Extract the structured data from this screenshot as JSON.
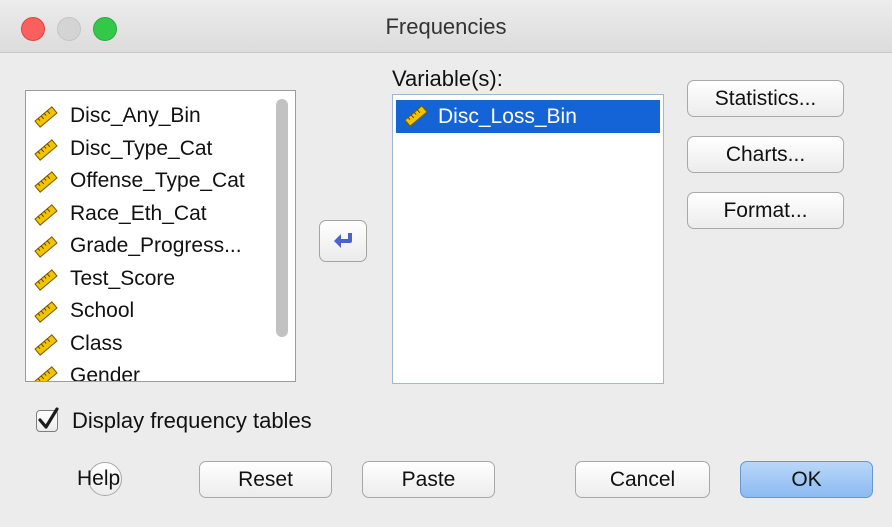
{
  "window": {
    "title": "Frequencies"
  },
  "source_list": {
    "items": [
      "Disc_Any_Bin",
      "Disc_Type_Cat",
      "Offense_Type_Cat",
      "Race_Eth_Cat",
      "Grade_Progress...",
      "Test_Score",
      "School",
      "Class",
      "Gender"
    ]
  },
  "target": {
    "label": "Variable(s):",
    "items": [
      "Disc_Loss_Bin"
    ]
  },
  "side_buttons": {
    "statistics": "Statistics...",
    "charts": "Charts...",
    "format": "Format..."
  },
  "display_tables": {
    "label": "Display frequency tables",
    "checked": true
  },
  "bottom_buttons": {
    "help": "Help",
    "reset": "Reset",
    "paste": "Paste",
    "cancel": "Cancel",
    "ok": "OK"
  },
  "icons": {
    "variable": "ruler-scale-icon",
    "move": "arrow-left-icon",
    "help": "question-icon"
  },
  "colors": {
    "selection": "#1464d8",
    "default_button": "#8cbaf2"
  }
}
